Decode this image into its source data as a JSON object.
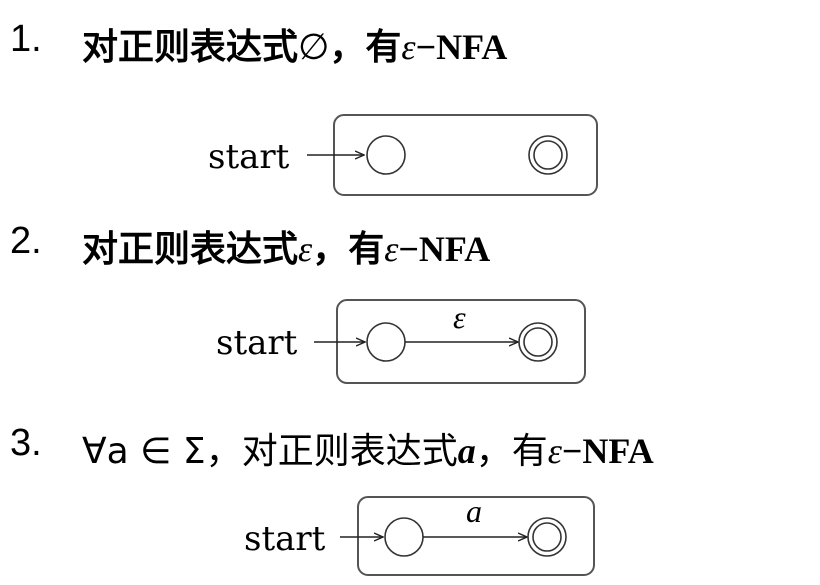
{
  "items": [
    {
      "number": "1.",
      "heading": {
        "prefix": "",
        "text": "对正则表达式",
        "regex": "∅",
        "sep": "，有",
        "eps": "ε",
        "dash": "−",
        "nfa": "NFA"
      },
      "automaton": {
        "start_label": "start",
        "transition_label": ""
      }
    },
    {
      "number": "2.",
      "heading": {
        "prefix": "",
        "text": "对正则表达式",
        "regex": "ε",
        "sep": "，有",
        "eps": "ε",
        "dash": "−",
        "nfa": "NFA"
      },
      "automaton": {
        "start_label": "start",
        "transition_label": "ε"
      }
    },
    {
      "number": "3.",
      "heading": {
        "prefix": "∀a ∈ Σ，",
        "text": "对正则表达式",
        "regex": "a",
        "sep": "，有",
        "eps": "ε",
        "dash": "−",
        "nfa": "NFA"
      },
      "automaton": {
        "start_label": "start",
        "transition_label": "a"
      }
    }
  ]
}
